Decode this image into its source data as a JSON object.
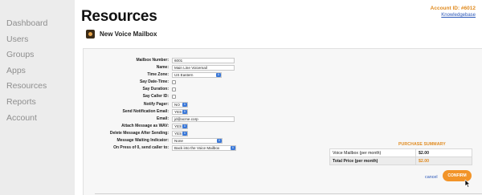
{
  "sidebar": {
    "items": [
      {
        "label": "Dashboard"
      },
      {
        "label": "Users"
      },
      {
        "label": "Groups"
      },
      {
        "label": "Apps"
      },
      {
        "label": "Resources"
      },
      {
        "label": "Reports"
      },
      {
        "label": "Account"
      }
    ]
  },
  "header": {
    "title": "Resources",
    "account_id": "Account ID: #6012",
    "knowledgebase_link": "Knowledgebase",
    "subtitle": "New Voice Mailbox"
  },
  "form": {
    "mailbox_number": {
      "label": "Mailbox Number:",
      "value": "6001"
    },
    "name": {
      "label": "Name:",
      "value": "Main Line Voicemail"
    },
    "time_zone": {
      "label": "Time Zone:",
      "value": "US Eastern"
    },
    "say_date_time": {
      "label": "Say Date-Time:"
    },
    "say_duration": {
      "label": "Say Duration:"
    },
    "say_caller_id": {
      "label": "Say Caller ID:"
    },
    "notify_pager": {
      "label": "Notify Pager:",
      "value": "NO"
    },
    "send_notification_email": {
      "label": "Send Notification Email:",
      "value": "YES"
    },
    "email": {
      "label": "Email:",
      "value": "jd@acme.corp"
    },
    "attach_message_as_wav": {
      "label": "Attach Message as WAV:",
      "value": "YES"
    },
    "delete_message_after_sending": {
      "label": "Delete Message After Sending:",
      "value": "YES"
    },
    "message_waiting_indicator": {
      "label": "Message Waiting Indicator:",
      "value": "None"
    },
    "on_press_of_0": {
      "label": "On Press of 0, send caller to:",
      "value": "Back into the Voice Mailbox"
    }
  },
  "purchase": {
    "title": "PURCHASE SUMMARY",
    "line_item": {
      "label": "Voice Mailbox (per month)",
      "price": "$2.00"
    },
    "total": {
      "label": "Total Price (per month)",
      "price": "$2.00"
    }
  },
  "actions": {
    "cancel_label": "cancel",
    "confirm_label": "CONFIRM"
  },
  "colors": {
    "accent": "#f29429",
    "link": "#2a57b8",
    "select_arrow": "#3a78d8",
    "sidebar_bg": "#ececec"
  },
  "icons": {
    "subheader_icon": "voicemail-icon",
    "select_arrow": "chevron-updown-icon",
    "pointer": "cursor-icon"
  }
}
